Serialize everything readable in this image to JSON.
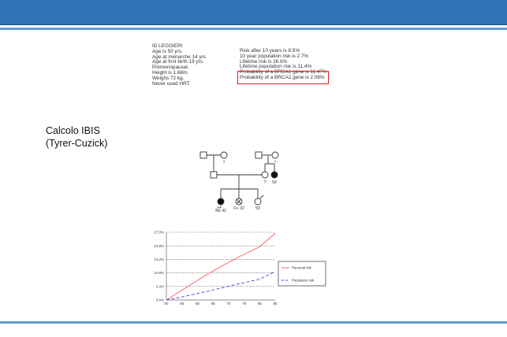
{
  "header": {
    "bar_color": "#2e74b5",
    "rule_color": "#5b9bd5"
  },
  "patient": {
    "id_line": "ID LEGGIERI",
    "lines": [
      "Age is 50 yrs.",
      "Age at menarche 14 yrs.",
      "Age at first birth 19 yrs.",
      "Premenopausal.",
      "Height is 1.68m.",
      "Weighs 72 kg.",
      "Never used HRT."
    ]
  },
  "risks": {
    "lines": [
      "Risk after 10 years is 8.5%",
      "10 year population risk is 2.7%",
      "Lifetime risk is 26.6%",
      "Lifetime population risk is 11.4%"
    ],
    "brca1": "Probability of a BRCA1 gene is 11.47%",
    "brca2": "Probability of a BRCA2 gene is 2.06%"
  },
  "label": {
    "line1": "Calcolo IBIS",
    "line2": "(Tyrer-Cuzick)"
  },
  "pedigree": {
    "labels": {
      "aunt_age": "50",
      "proband_id": "BE 42",
      "sister_age": "O+ 32",
      "cousin_age": "50",
      "sister_mark": "+4"
    },
    "affected_color": "#111111"
  },
  "chart_data": {
    "type": "line",
    "x": [
      50,
      55,
      60,
      65,
      70,
      75,
      80,
      85
    ],
    "x_ticks": [
      "50",
      "55",
      "60",
      "65",
      "70",
      "75",
      "80",
      "85"
    ],
    "y_ticks": [
      "0.0%",
      "5.4%",
      "10.8%",
      "16.2%",
      "21.6%",
      "27.0%"
    ],
    "ylim": [
      0,
      27.0
    ],
    "xlim": [
      50,
      85
    ],
    "grid": true,
    "legend": "right",
    "series": [
      {
        "name": "Personal risk",
        "color": "#ff5a5a",
        "dash": false,
        "x": [
          50,
          55,
          60,
          65,
          70,
          75,
          80,
          85
        ],
        "values": [
          0,
          3.9,
          7.8,
          11.6,
          15.0,
          18.2,
          21.2,
          26.6
        ]
      },
      {
        "name": "Population risk",
        "color": "#3a4bcc",
        "dash": true,
        "x": [
          50,
          55,
          60,
          65,
          70,
          75,
          80,
          85
        ],
        "values": [
          0,
          1.2,
          2.6,
          4.0,
          5.5,
          6.9,
          8.3,
          11.4
        ]
      }
    ]
  }
}
